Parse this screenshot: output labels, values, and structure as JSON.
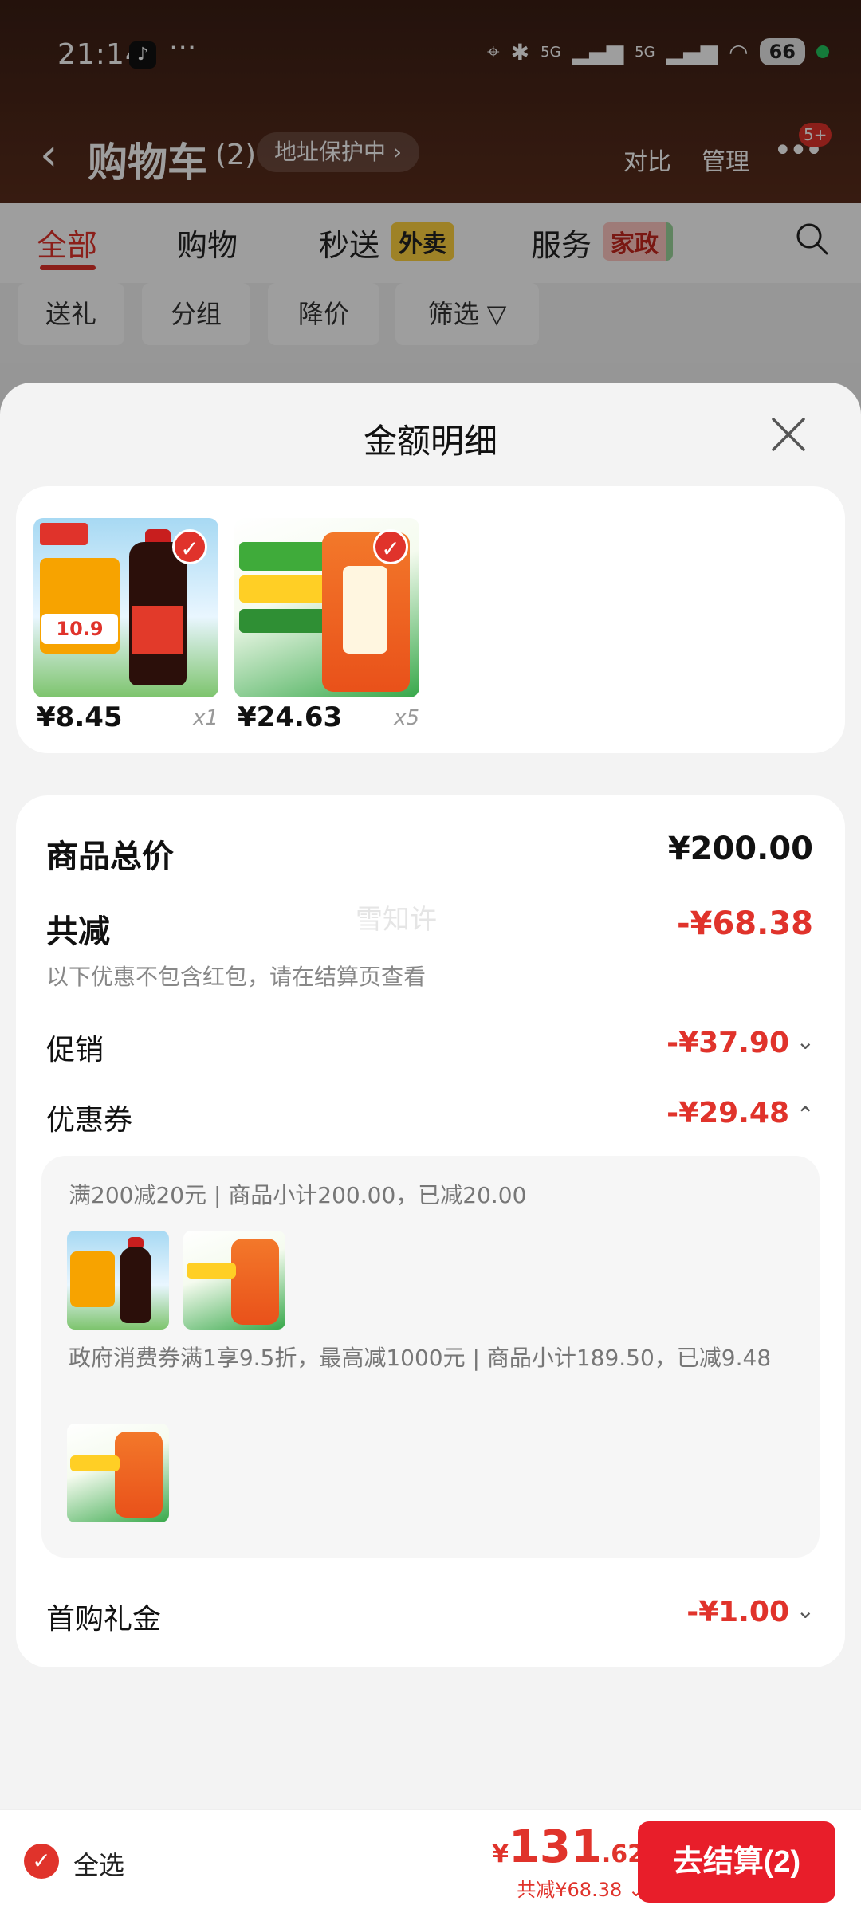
{
  "status_bar": {
    "time": "21:14",
    "app_icon": "douyin-icon",
    "dots": "···",
    "signal_1": "5G",
    "signal_2": "5G",
    "battery": "66"
  },
  "nav": {
    "title": "购物车",
    "count": "(2)",
    "address_protect": "地址保护中 ›",
    "compare": "对比",
    "manage": "管理",
    "more": "•••",
    "badge": "5+"
  },
  "tabs": [
    {
      "label": "全部",
      "active": true
    },
    {
      "label": "购物"
    },
    {
      "label": "秒送",
      "tag": "外卖"
    },
    {
      "label": "服务",
      "tag": "家政"
    }
  ],
  "chips": [
    "送礼",
    "分组",
    "降价",
    "筛选 ▽"
  ],
  "sheet": {
    "title": "金额明细",
    "products": [
      {
        "price": "¥8.45",
        "qty": "x1",
        "image": "soy-sauce-bottle",
        "checked": true
      },
      {
        "price": "¥24.63",
        "qty": "x5",
        "image": "rice-bag",
        "checked": true
      }
    ],
    "amounts": {
      "total_label": "商品总价",
      "total_value": "¥200.00",
      "discount_label": "共减",
      "discount_value": "-¥68.38",
      "discount_note": "以下优惠不包含红包，请在结算页查看",
      "watermark": "雪知许",
      "promo_label": "促销",
      "promo_value": "-¥37.90",
      "coupon_label": "优惠券",
      "coupon_value": "-¥29.48",
      "coupon_details": [
        {
          "text": "满200减20元 | 商品小计200.00，已减20.00",
          "thumbs": [
            "soy-sauce-bottle",
            "rice-bag"
          ]
        },
        {
          "text": "政府消费券满1享9.5折，最高减1000元 | 商品小计189.50，已减9.48",
          "thumbs": [
            "rice-bag"
          ]
        }
      ],
      "first_buy_label": "首购礼金",
      "first_buy_value": "-¥1.00"
    }
  },
  "bottom_bar": {
    "select_all": "全选",
    "price_currency": "¥",
    "price_int": "131",
    "price_dec": ".62",
    "saved": "共减¥68.38",
    "checkout": "去结算(2)"
  },
  "colors": {
    "accent_red": "#e0332b",
    "header_brown": "#4a2517",
    "checkout_red": "#e81e2a"
  }
}
